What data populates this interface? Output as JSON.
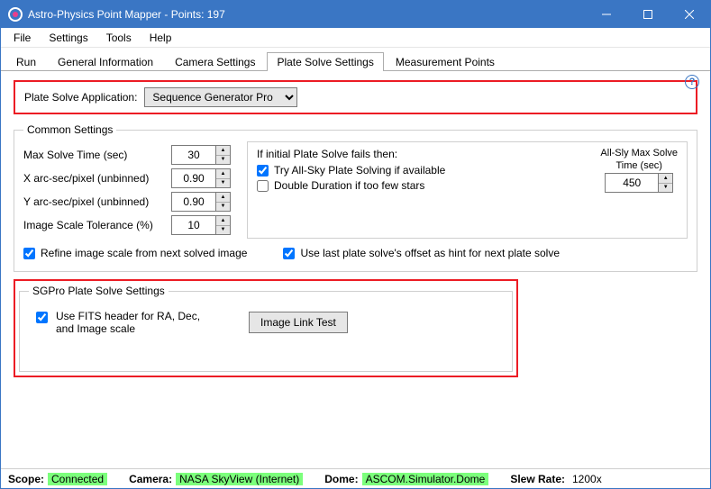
{
  "window": {
    "title": "Astro-Physics Point Mapper - Points: 197"
  },
  "menu": {
    "file": "File",
    "settings": "Settings",
    "tools": "Tools",
    "help": "Help"
  },
  "tabs": {
    "run": "Run",
    "general": "General Information",
    "camera": "Camera Settings",
    "plate": "Plate Solve Settings",
    "measurement": "Measurement Points"
  },
  "help_icon": "?",
  "plateSolve": {
    "appLabel": "Plate Solve Application:",
    "appSelected": "Sequence Generator Pro"
  },
  "common": {
    "legend": "Common Settings",
    "maxSolveLabel": "Max Solve Time (sec)",
    "maxSolveValue": "30",
    "xArcLabel": "X arc-sec/pixel (unbinned)",
    "xArcValue": "0.90",
    "yArcLabel": "Y arc-sec/pixel (unbinned)",
    "yArcValue": "0.90",
    "tolLabel": "Image Scale Tolerance (%)",
    "tolValue": "10",
    "failLegend": "If initial Plate Solve fails then:",
    "tryAllSky": "Try All-Sky Plate Solving if available",
    "doubleDuration": "Double Duration if too few stars",
    "allSkyCaption1": "All-Sly Max Solve",
    "allSkyCaption2": "Time (sec)",
    "allSkyValue": "450",
    "refine": "Refine image scale from next solved image",
    "useOffset": "Use last plate solve's offset as hint for next plate solve"
  },
  "sgpro": {
    "legend": "SGPro Plate Solve Settings",
    "useFits": "Use FITS header for RA, Dec, and Image scale",
    "imageLinkTest": "Image Link Test"
  },
  "status": {
    "scopeLabel": "Scope:",
    "scopeValue": "Connected",
    "cameraLabel": "Camera:",
    "cameraValue": "NASA SkyView (Internet)",
    "domeLabel": "Dome:",
    "domeValue": "ASCOM.Simulator.Dome",
    "slewLabel": "Slew Rate:",
    "slewValue": "1200x"
  }
}
